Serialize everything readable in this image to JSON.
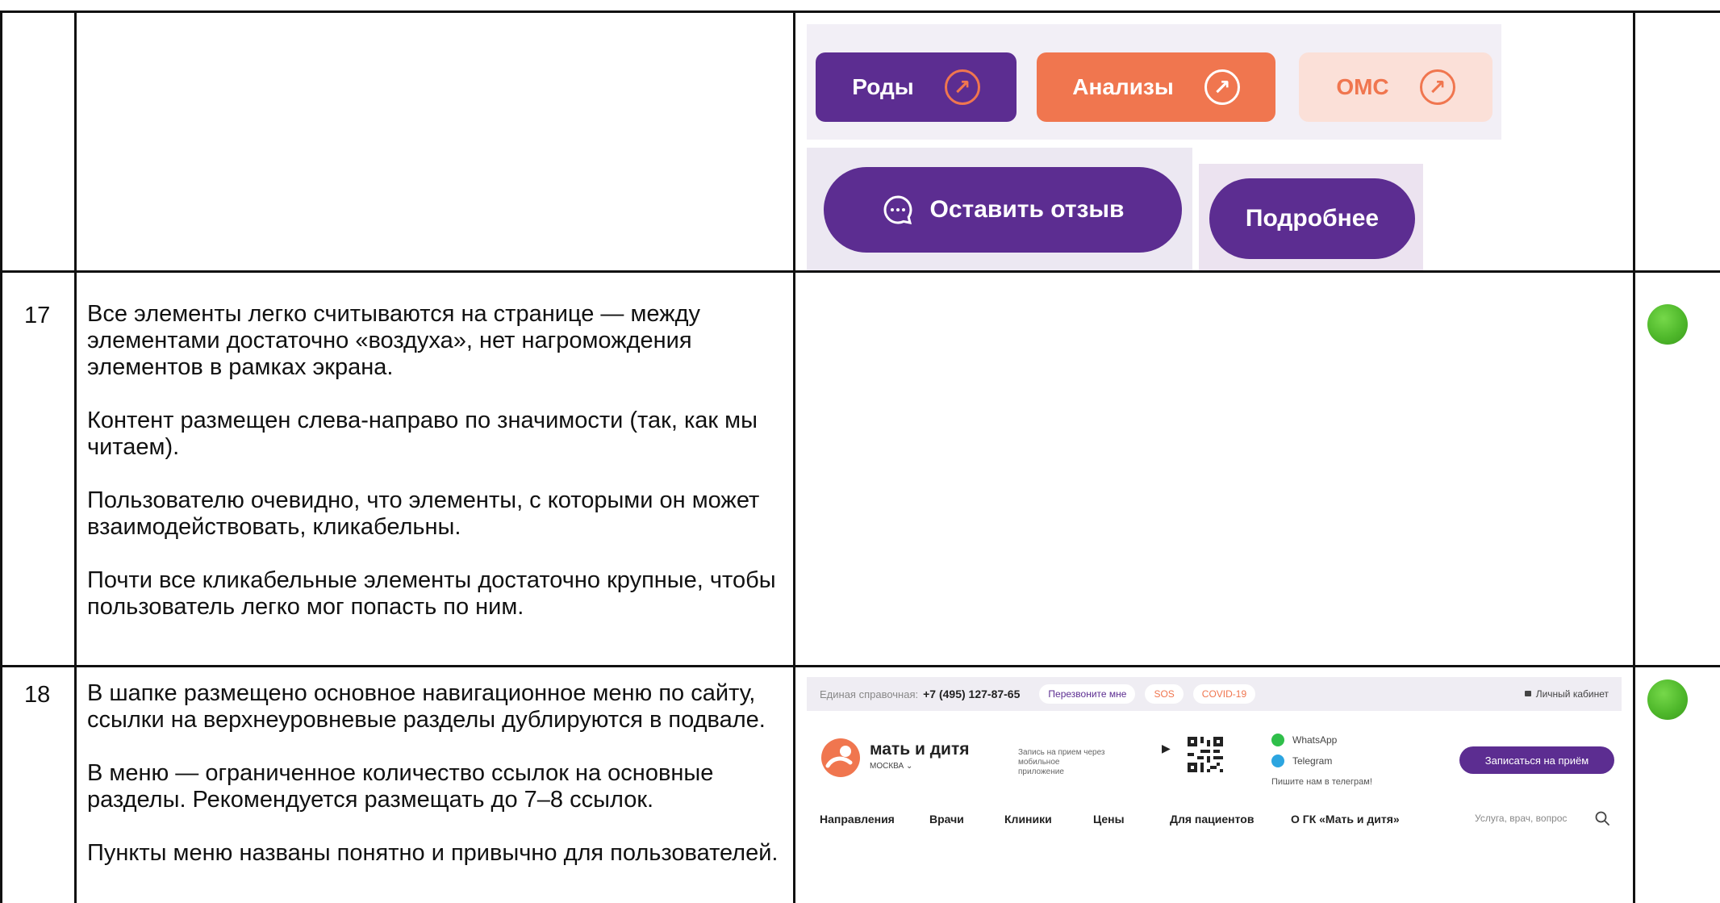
{
  "rows": [
    {
      "number": "17",
      "paragraphs": [
        "Все элементы легко считываются на странице — между элементами достаточно «воздуха», нет нагромождения элементов в рамках экрана.",
        "Контент размещен слева-направо по значимости (так, как мы читаем).",
        "Пользователю очевидно, что элементы, с которыми он может взаимодействовать, кликабельны.",
        "Почти все кликабельные элементы достаточно крупные, чтобы пользователь легко мог попасть по ним."
      ],
      "status_color": "#4fb82b"
    },
    {
      "number": "18",
      "paragraphs": [
        "В шапке размещено основное навигационное меню по сайту, ссылки на верхнеуровневые разделы дублируются в подвале.",
        "В меню — ограниченное количество ссылок на основные разделы. Рекомендуется размещать до 7–8 ссылок.",
        "Пункты меню названы понятно и привычно для пользователей."
      ],
      "status_color": "#4fb82b"
    }
  ],
  "button_examples": {
    "rody": "Роды",
    "analyzy": "Анализы",
    "oms": "ОМС",
    "feedback": "Оставить отзыв",
    "more": "Подробнее",
    "colors": {
      "purple": "#5c2d91",
      "orange": "#f0764f",
      "peach": "#fbe0d8",
      "peach_text": "#f0764f"
    }
  },
  "site": {
    "topbar": {
      "hotline_label": "Единая справочная:",
      "phone": "+7 (495) 127-87-65",
      "callback": "Перезвоните мне",
      "sos": "SOS",
      "covid": "COVID-19",
      "account": "Личный кабинет"
    },
    "logo_name": "мать и дитя",
    "city": "МОСКВА",
    "app_promo": "Запись на прием через мобильное приложение",
    "whatsapp": "WhatsApp",
    "telegram": "Telegram",
    "telegram_note": "Пишите нам в телеграм!",
    "cta": "Записаться на приём",
    "nav": [
      "Направления",
      "Врачи",
      "Клиники",
      "Цены",
      "Для пациентов",
      "О ГК «Мать и дитя»"
    ],
    "search_placeholder": "Услуга, врач, вопрос"
  }
}
